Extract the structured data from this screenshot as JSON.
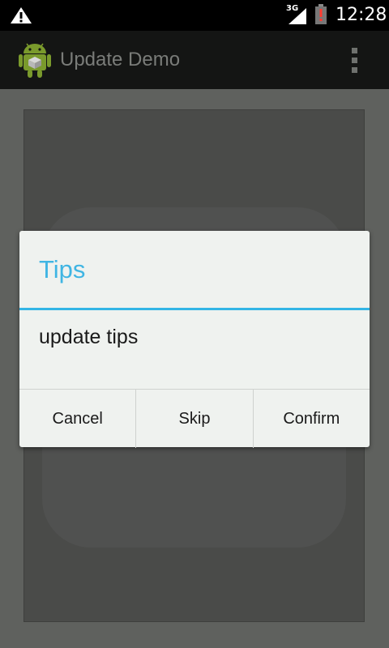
{
  "status_bar": {
    "network_label": "3G",
    "time": "12:28",
    "icons": [
      "warning-icon",
      "signal-icon",
      "battery-low-icon"
    ]
  },
  "action_bar": {
    "title": "Update Demo",
    "icons": [
      "android-app-icon",
      "overflow-menu-icon"
    ]
  },
  "dialog": {
    "title": "Tips",
    "message": "update tips",
    "accent_color": "#33b5e5",
    "buttons": {
      "cancel": "Cancel",
      "skip": "Skip",
      "confirm": "Confirm"
    }
  }
}
